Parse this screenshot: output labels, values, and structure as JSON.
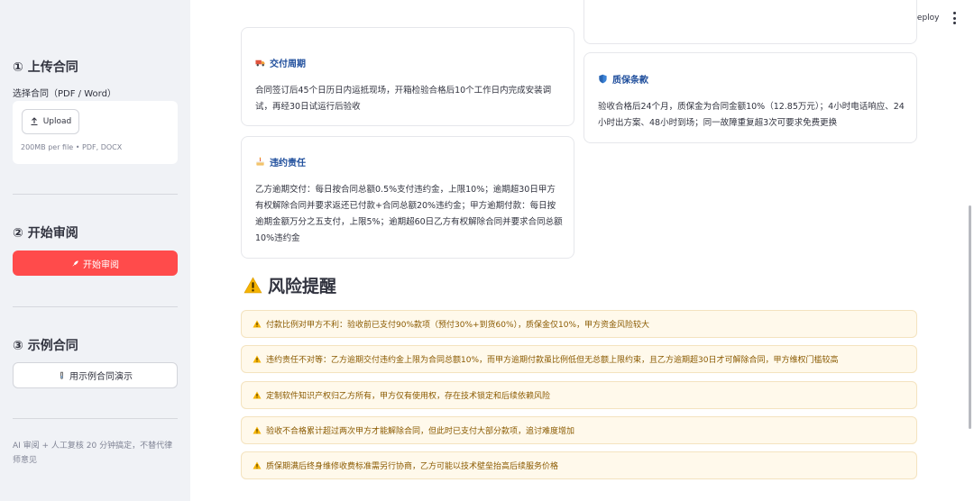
{
  "sidebar": {
    "upload_heading": "① 上传合同",
    "select_label": "选择合同（PDF / Word）",
    "upload_button": "Upload",
    "upload_hint": "200MB per file • PDF, DOCX",
    "review_heading": "② 开始审阅",
    "start_button": "开始审阅",
    "example_heading": "③ 示例合同",
    "example_button": "用示例合同演示",
    "footer": "AI 审阅 + 人工复核 20 分钟搞定，不替代律师意见"
  },
  "header": {
    "deploy": "Deploy"
  },
  "cards": {
    "delivery": {
      "title": "交付周期",
      "body": "合同签订后45个日历日内运抵现场，开箱检验合格后10个工作日内完成安装调试，再经30日试运行后验收"
    },
    "warranty": {
      "title": "质保条款",
      "body": "验收合格后24个月，质保金为合同金额10%（12.85万元）；4小时电话响应、24小时出方案、48小时到场；同一故障重复超3次可要求免费更换"
    },
    "breach": {
      "title": "违约责任",
      "body": "乙方逾期交付：每日按合同总额0.5%支付违约金，上限10%；逾期超30日甲方有权解除合同并要求返还已付款+合同总额20%违约金；甲方逾期付款：每日按逾期金额万分之五支付，上限5%；逾期超60日乙方有权解除合同并要求合同总额10%违约金"
    }
  },
  "risk": {
    "heading": "风险提醒",
    "items": [
      "付款比例对甲方不利：验收前已支付90%款项（预付30%+到货60%），质保金仅10%，甲方资金风险较大",
      "违约责任不对等：乙方逾期交付违约金上限为合同总额10%，而甲方逾期付款虽比例低但无总额上限约束，且乙方逾期超30日才可解除合同，甲方维权门槛较高",
      "定制软件知识产权归乙方所有，甲方仅有使用权，存在技术锁定和后续依赖风险",
      "验收不合格累计超过两次甲方才能解除合同，但此时已支付大部分款项，追讨难度增加",
      "质保期满后终身维修收费标准需另行协商，乙方可能以技术壁垒抬高后续服务价格"
    ]
  },
  "colors": {
    "primary": "#ff4b4b",
    "sidebar_bg": "#f0f2f6",
    "card_title": "#1f4e9c",
    "warning_bg": "#fff9eb",
    "warning_text": "#8a5a00"
  },
  "icons": {
    "delivery": "truck-icon",
    "warranty": "shield-icon",
    "breach": "cake-icon",
    "risk": "warning-icon",
    "upload": "upload-icon",
    "start": "rocket-icon",
    "example": "test-tube-icon",
    "menu": "more-vertical-icon"
  }
}
